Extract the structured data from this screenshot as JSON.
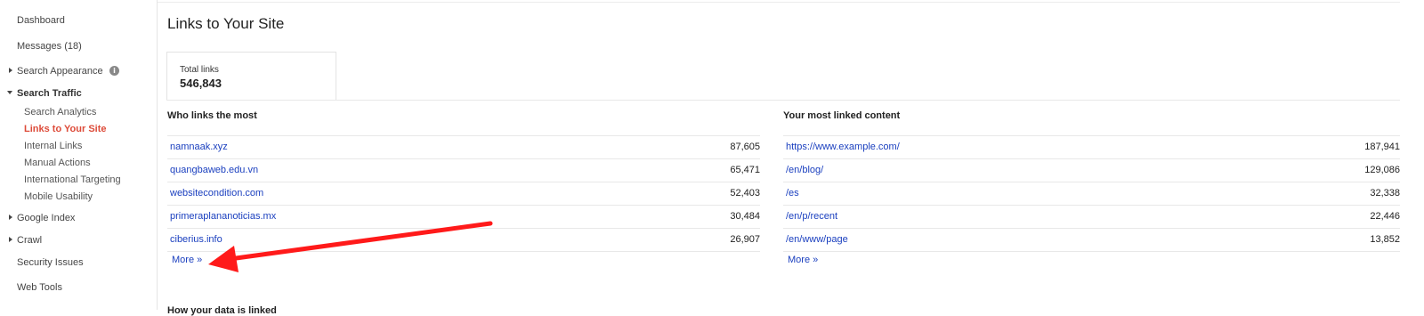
{
  "sidebar": {
    "dashboard": "Dashboard",
    "messages": "Messages (18)",
    "search_appearance": "Search Appearance",
    "search_traffic": "Search Traffic",
    "search_traffic_items": [
      "Search Analytics",
      "Links to Your Site",
      "Internal Links",
      "Manual Actions",
      "International Targeting",
      "Mobile Usability"
    ],
    "google_index": "Google Index",
    "crawl": "Crawl",
    "security_issues": "Security Issues",
    "web_tools": "Web Tools",
    "info_icon": "i"
  },
  "main": {
    "title": "Links to Your Site",
    "total_links_label": "Total links",
    "total_links_value": "546,843",
    "who_links_title": "Who links the most",
    "who_links": [
      {
        "name": "namnaak.xyz",
        "value": "87,605"
      },
      {
        "name": "quangbaweb.edu.vn",
        "value": "65,471"
      },
      {
        "name": "websitecondition.com",
        "value": "52,403"
      },
      {
        "name": "primeraplananoticias.mx",
        "value": "30,484"
      },
      {
        "name": "ciberius.info",
        "value": "26,907"
      }
    ],
    "linked_content_title": "Your most linked content",
    "linked_content": [
      {
        "name": "https://www.example.com/",
        "value": "187,941"
      },
      {
        "name": "/en/blog/",
        "value": "129,086"
      },
      {
        "name": "/es",
        "value": "32,338"
      },
      {
        "name": "/en/p/recent",
        "value": "22,446"
      },
      {
        "name": "/en/www/page",
        "value": "13,852"
      }
    ],
    "more_label": "More »",
    "cutoff_text": "How your data is linked"
  },
  "colors": {
    "link": "#1a3fbf",
    "active": "#dd4b39",
    "arrow": "#ff1a1a"
  }
}
